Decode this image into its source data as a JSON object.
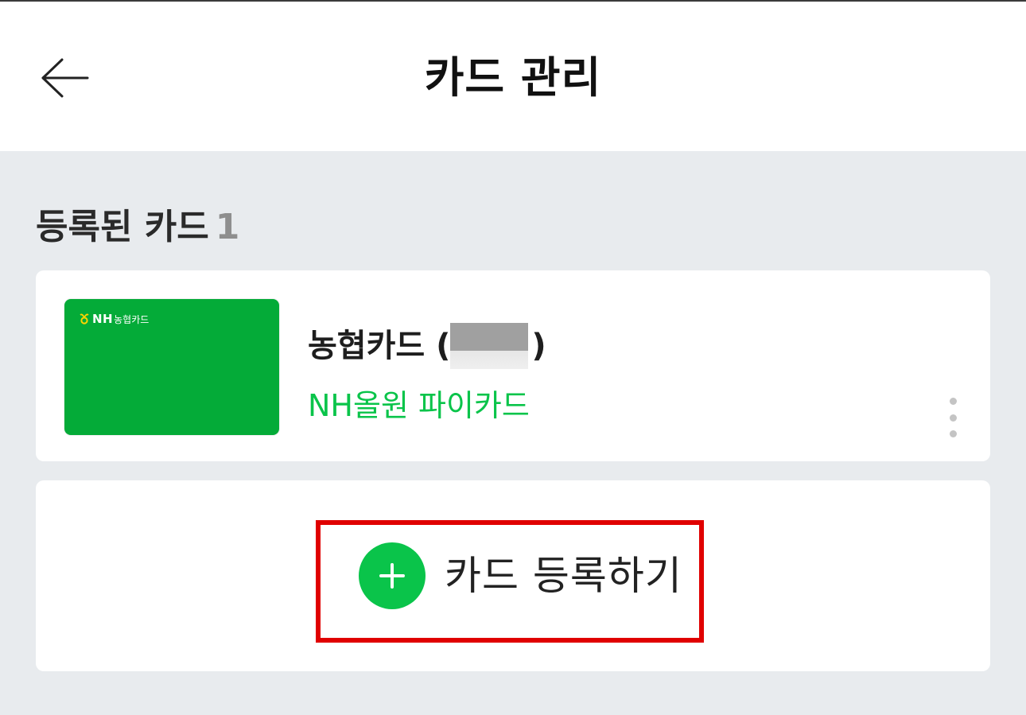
{
  "header": {
    "title": "카드 관리"
  },
  "registered": {
    "title": "등록된 카드",
    "count": "1"
  },
  "cards": [
    {
      "issuer_name": "농협카드 (",
      "issuer_name_close": ")",
      "product_name": "NH올원 파이카드",
      "image": {
        "logo_text": "NH",
        "logo_subtext": "농협카드",
        "color": "#04ab38"
      }
    }
  ],
  "register_button": {
    "label": "카드 등록하기"
  },
  "colors": {
    "accent_green": "#0ac44a",
    "highlight_red": "#e00000",
    "background": "#e8ebee"
  },
  "icons": {
    "back": "arrow-left-icon",
    "more": "more-vertical-icon",
    "add": "plus-icon"
  }
}
